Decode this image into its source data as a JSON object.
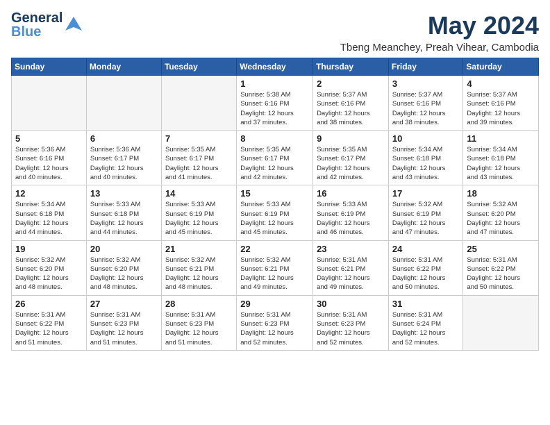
{
  "logo": {
    "line1": "General",
    "line2": "Blue",
    "bird": "▲"
  },
  "title": "May 2024",
  "location": "Tbeng Meanchey, Preah Vihear, Cambodia",
  "days_of_week": [
    "Sunday",
    "Monday",
    "Tuesday",
    "Wednesday",
    "Thursday",
    "Friday",
    "Saturday"
  ],
  "weeks": [
    [
      {
        "day": "",
        "info": ""
      },
      {
        "day": "",
        "info": ""
      },
      {
        "day": "",
        "info": ""
      },
      {
        "day": "1",
        "info": "Sunrise: 5:38 AM\nSunset: 6:16 PM\nDaylight: 12 hours\nand 37 minutes."
      },
      {
        "day": "2",
        "info": "Sunrise: 5:37 AM\nSunset: 6:16 PM\nDaylight: 12 hours\nand 38 minutes."
      },
      {
        "day": "3",
        "info": "Sunrise: 5:37 AM\nSunset: 6:16 PM\nDaylight: 12 hours\nand 38 minutes."
      },
      {
        "day": "4",
        "info": "Sunrise: 5:37 AM\nSunset: 6:16 PM\nDaylight: 12 hours\nand 39 minutes."
      }
    ],
    [
      {
        "day": "5",
        "info": "Sunrise: 5:36 AM\nSunset: 6:16 PM\nDaylight: 12 hours\nand 40 minutes."
      },
      {
        "day": "6",
        "info": "Sunrise: 5:36 AM\nSunset: 6:17 PM\nDaylight: 12 hours\nand 40 minutes."
      },
      {
        "day": "7",
        "info": "Sunrise: 5:35 AM\nSunset: 6:17 PM\nDaylight: 12 hours\nand 41 minutes."
      },
      {
        "day": "8",
        "info": "Sunrise: 5:35 AM\nSunset: 6:17 PM\nDaylight: 12 hours\nand 42 minutes."
      },
      {
        "day": "9",
        "info": "Sunrise: 5:35 AM\nSunset: 6:17 PM\nDaylight: 12 hours\nand 42 minutes."
      },
      {
        "day": "10",
        "info": "Sunrise: 5:34 AM\nSunset: 6:18 PM\nDaylight: 12 hours\nand 43 minutes."
      },
      {
        "day": "11",
        "info": "Sunrise: 5:34 AM\nSunset: 6:18 PM\nDaylight: 12 hours\nand 43 minutes."
      }
    ],
    [
      {
        "day": "12",
        "info": "Sunrise: 5:34 AM\nSunset: 6:18 PM\nDaylight: 12 hours\nand 44 minutes."
      },
      {
        "day": "13",
        "info": "Sunrise: 5:33 AM\nSunset: 6:18 PM\nDaylight: 12 hours\nand 44 minutes."
      },
      {
        "day": "14",
        "info": "Sunrise: 5:33 AM\nSunset: 6:19 PM\nDaylight: 12 hours\nand 45 minutes."
      },
      {
        "day": "15",
        "info": "Sunrise: 5:33 AM\nSunset: 6:19 PM\nDaylight: 12 hours\nand 45 minutes."
      },
      {
        "day": "16",
        "info": "Sunrise: 5:33 AM\nSunset: 6:19 PM\nDaylight: 12 hours\nand 46 minutes."
      },
      {
        "day": "17",
        "info": "Sunrise: 5:32 AM\nSunset: 6:19 PM\nDaylight: 12 hours\nand 47 minutes."
      },
      {
        "day": "18",
        "info": "Sunrise: 5:32 AM\nSunset: 6:20 PM\nDaylight: 12 hours\nand 47 minutes."
      }
    ],
    [
      {
        "day": "19",
        "info": "Sunrise: 5:32 AM\nSunset: 6:20 PM\nDaylight: 12 hours\nand 48 minutes."
      },
      {
        "day": "20",
        "info": "Sunrise: 5:32 AM\nSunset: 6:20 PM\nDaylight: 12 hours\nand 48 minutes."
      },
      {
        "day": "21",
        "info": "Sunrise: 5:32 AM\nSunset: 6:21 PM\nDaylight: 12 hours\nand 48 minutes."
      },
      {
        "day": "22",
        "info": "Sunrise: 5:32 AM\nSunset: 6:21 PM\nDaylight: 12 hours\nand 49 minutes."
      },
      {
        "day": "23",
        "info": "Sunrise: 5:31 AM\nSunset: 6:21 PM\nDaylight: 12 hours\nand 49 minutes."
      },
      {
        "day": "24",
        "info": "Sunrise: 5:31 AM\nSunset: 6:22 PM\nDaylight: 12 hours\nand 50 minutes."
      },
      {
        "day": "25",
        "info": "Sunrise: 5:31 AM\nSunset: 6:22 PM\nDaylight: 12 hours\nand 50 minutes."
      }
    ],
    [
      {
        "day": "26",
        "info": "Sunrise: 5:31 AM\nSunset: 6:22 PM\nDaylight: 12 hours\nand 51 minutes."
      },
      {
        "day": "27",
        "info": "Sunrise: 5:31 AM\nSunset: 6:23 PM\nDaylight: 12 hours\nand 51 minutes."
      },
      {
        "day": "28",
        "info": "Sunrise: 5:31 AM\nSunset: 6:23 PM\nDaylight: 12 hours\nand 51 minutes."
      },
      {
        "day": "29",
        "info": "Sunrise: 5:31 AM\nSunset: 6:23 PM\nDaylight: 12 hours\nand 52 minutes."
      },
      {
        "day": "30",
        "info": "Sunrise: 5:31 AM\nSunset: 6:23 PM\nDaylight: 12 hours\nand 52 minutes."
      },
      {
        "day": "31",
        "info": "Sunrise: 5:31 AM\nSunset: 6:24 PM\nDaylight: 12 hours\nand 52 minutes."
      },
      {
        "day": "",
        "info": ""
      }
    ]
  ]
}
